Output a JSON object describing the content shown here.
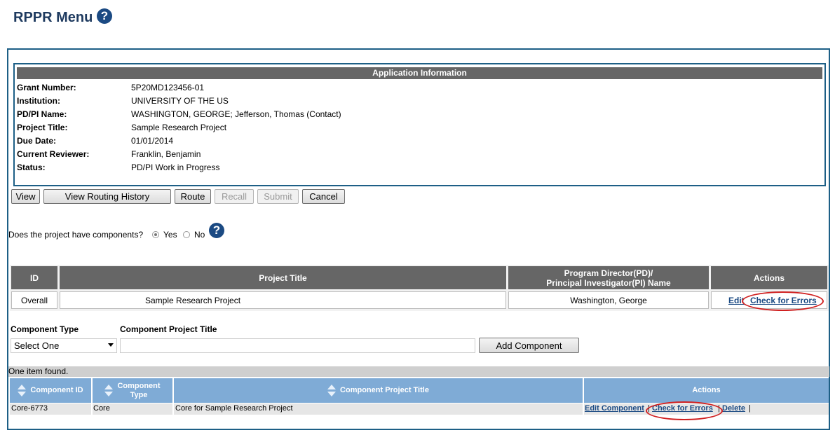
{
  "page": {
    "title": "RPPR Menu",
    "help_icon": "?"
  },
  "app_info": {
    "header": "Application Information",
    "fields": [
      {
        "label": "Grant Number:",
        "value": "5P20MD123456-01"
      },
      {
        "label": "Institution:",
        "value": "UNIVERSITY OF THE US"
      },
      {
        "label": "PD/PI Name:",
        "value": "WASHINGTON, GEORGE; Jefferson, Thomas (Contact)"
      },
      {
        "label": "Project Title:",
        "value": "Sample Research Project"
      },
      {
        "label": "Due Date:",
        "value": "01/01/2014"
      },
      {
        "label": "Current Reviewer:",
        "value": "Franklin, Benjamin"
      },
      {
        "label": "Status:",
        "value": "PD/PI Work in Progress"
      }
    ]
  },
  "toolbar": {
    "view": "View",
    "routing": "View Routing History",
    "route": "Route",
    "recall": "Recall",
    "submit": "Submit",
    "cancel": "Cancel"
  },
  "components_question": {
    "text": "Does the project have components?",
    "yes": "Yes",
    "no": "No",
    "selected": "Yes"
  },
  "project_table": {
    "headers": {
      "id": "ID",
      "title": "Project Title",
      "pd_line1": "Program Director(PD)/",
      "pd_line2": "Principal Investigator(PI) Name",
      "actions": "Actions"
    },
    "row": {
      "id": "Overall",
      "title": "Sample Research Project",
      "pi": "Washington, George",
      "edit": "Edit",
      "check": "Check for Errors"
    }
  },
  "add_component": {
    "type_label": "Component Type",
    "title_label": "Component Project Title",
    "type_selected": "Select One",
    "title_value": "",
    "add_button": "Add Component"
  },
  "components_list": {
    "count_text": "One item found.",
    "headers": {
      "id": "Component ID",
      "type_line1": "Component",
      "type_line2": "Type",
      "title": "Component Project Title",
      "actions": "Actions"
    },
    "rows": [
      {
        "id": "Core-6773",
        "type": "Core",
        "title": "Core for Sample Research Project",
        "edit": "Edit Component",
        "check": "Check for Errors",
        "delete": "Delete"
      }
    ]
  },
  "colors": {
    "title": "#1e3a5f",
    "border": "#1d5f86",
    "dark_header": "#666666",
    "blue_header": "#7fabd6",
    "link": "#1b4a83",
    "highlight": "#d02020"
  }
}
